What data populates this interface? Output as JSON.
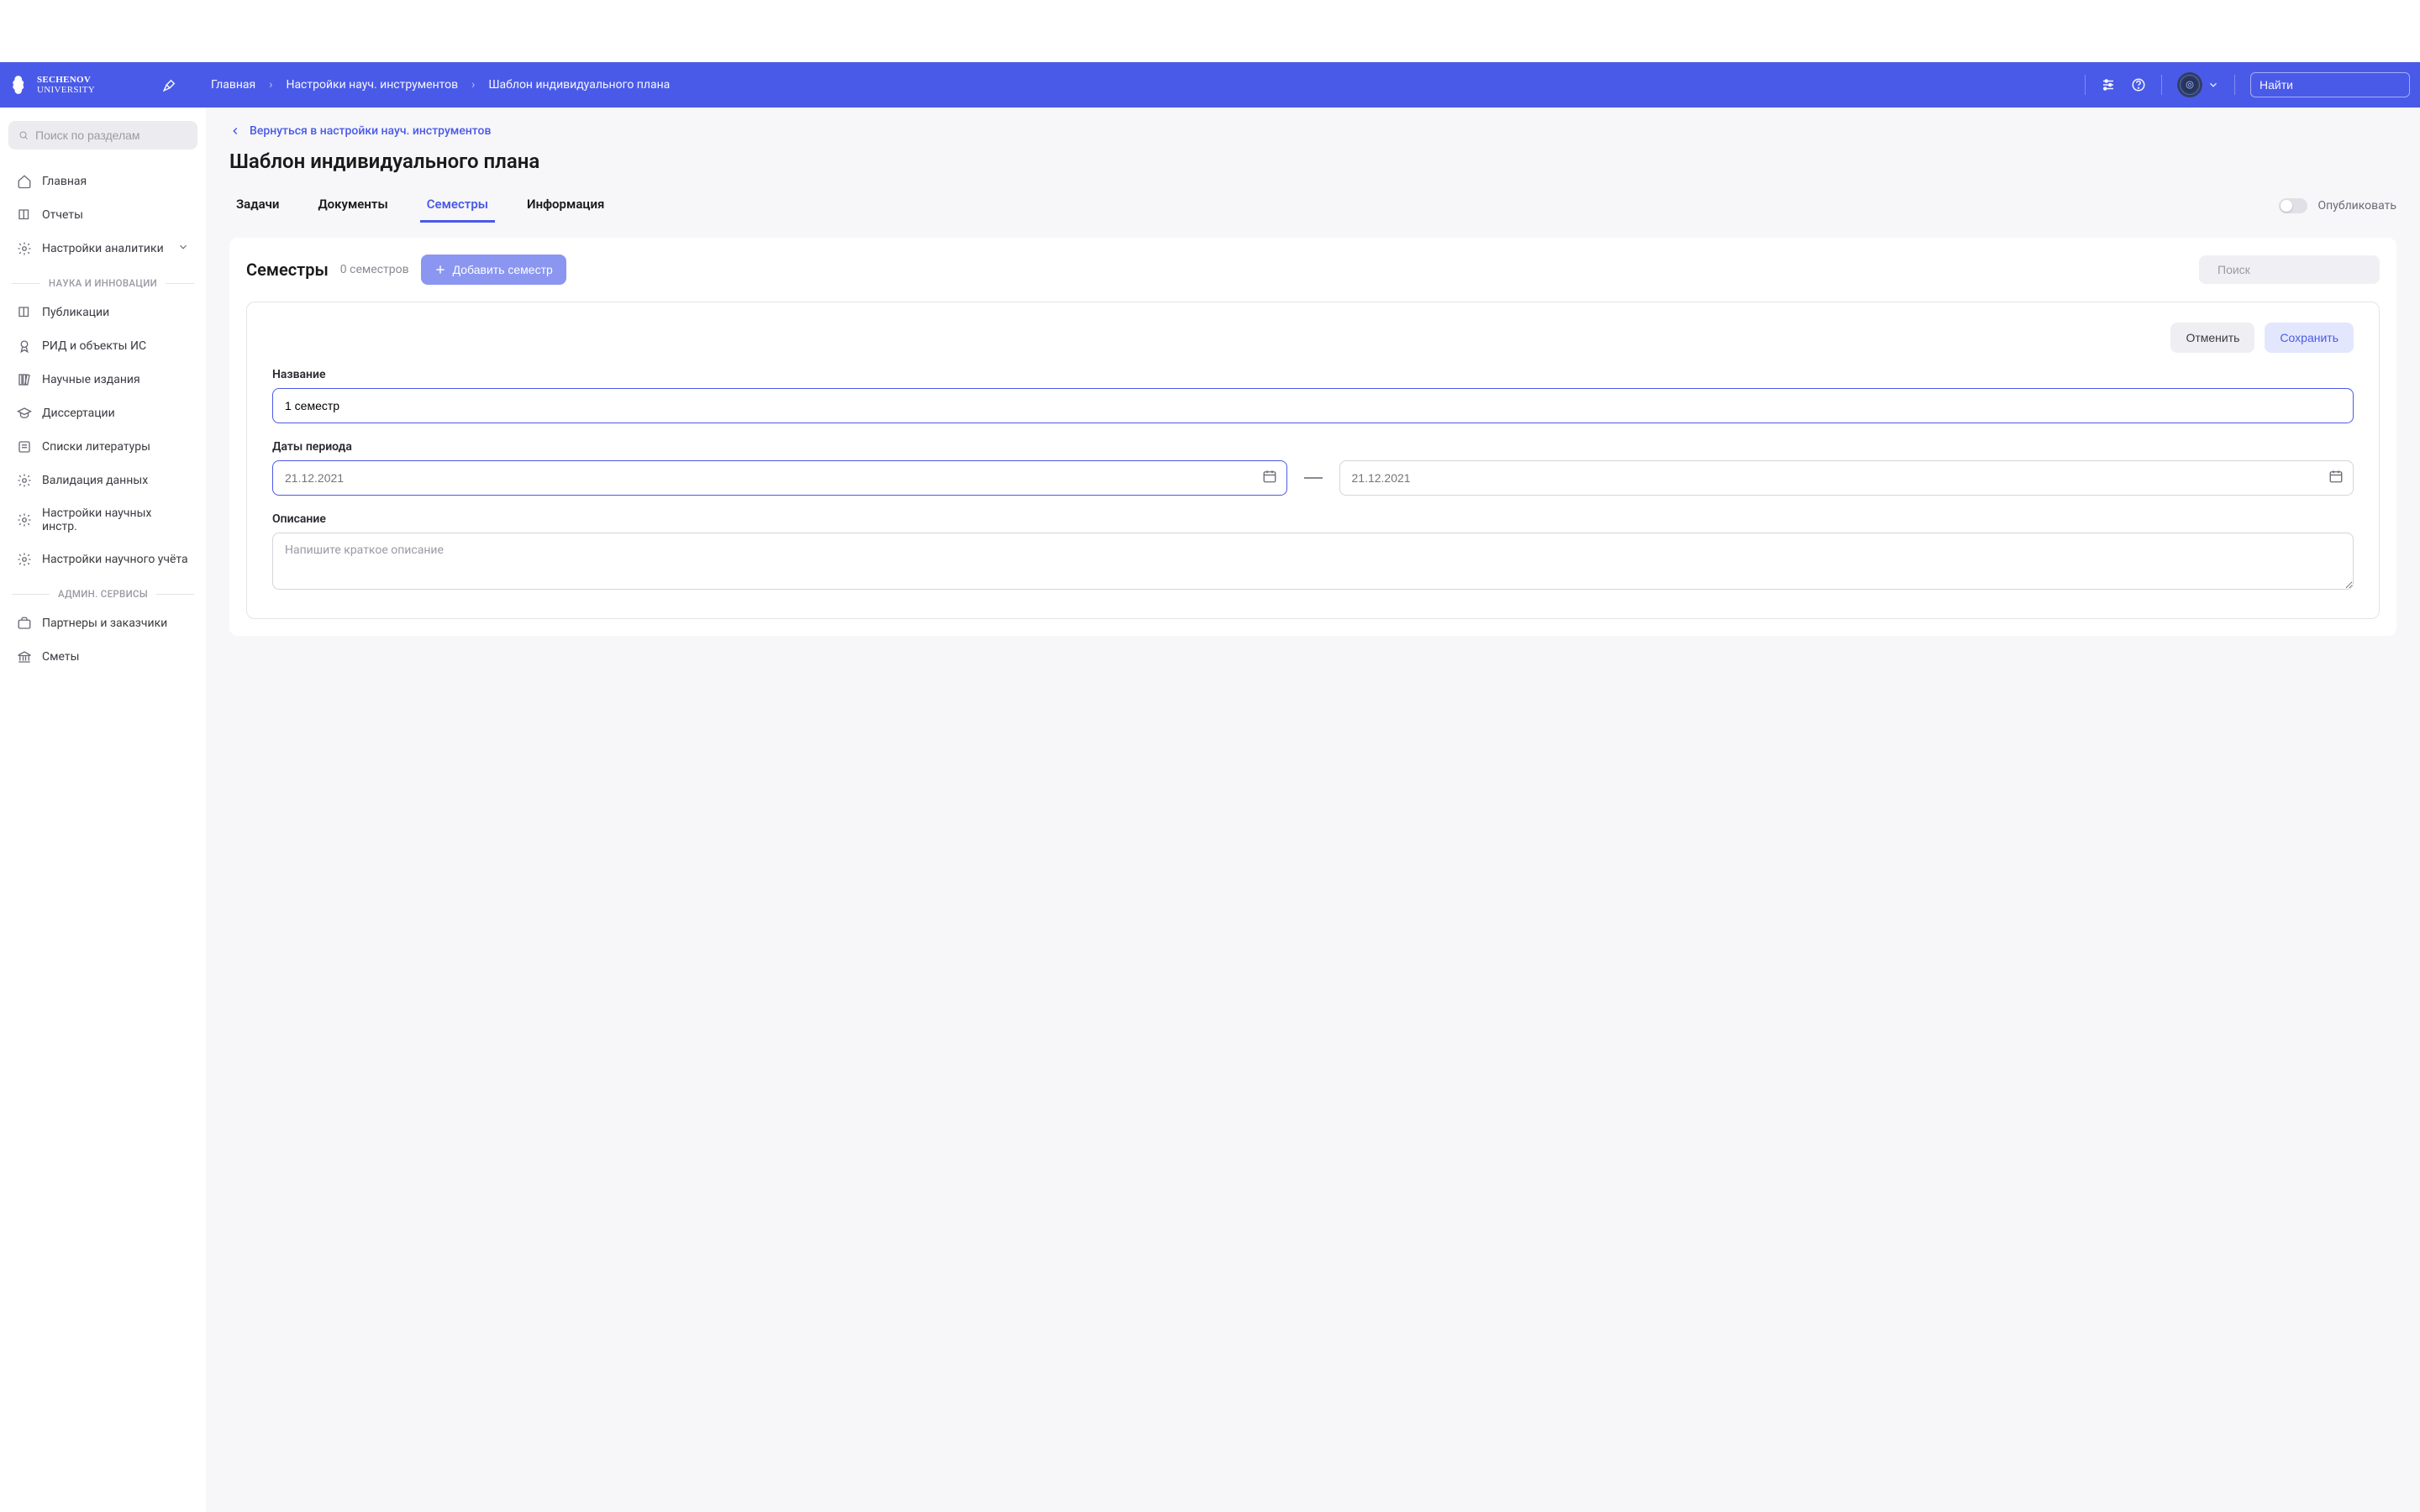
{
  "header": {
    "brand_line1": "Sechenov",
    "brand_line2": "University",
    "breadcrumbs": [
      "Главная",
      "Настройки науч. инструментов",
      "Шаблон индивидуального плана"
    ],
    "search_placeholder": "Найти"
  },
  "sidebar": {
    "search_placeholder": "Поиск по разделам",
    "items_top": [
      {
        "label": "Главная",
        "icon": "home"
      },
      {
        "label": "Отчеты",
        "icon": "book"
      },
      {
        "label": "Настройки аналитики",
        "icon": "gear",
        "expandable": true
      }
    ],
    "section_science": "НАУКА И ИННОВАЦИИ",
    "items_science": [
      {
        "label": "Публикации",
        "icon": "book"
      },
      {
        "label": "РИД и объекты ИС",
        "icon": "award"
      },
      {
        "label": "Научные издания",
        "icon": "library"
      },
      {
        "label": "Диссертации",
        "icon": "grad"
      },
      {
        "label": "Списки литературы",
        "icon": "list"
      },
      {
        "label": "Валидация данных",
        "icon": "gear"
      },
      {
        "label": "Настройки научных инстр.",
        "icon": "gear"
      },
      {
        "label": "Настройки научного учёта",
        "icon": "gear"
      }
    ],
    "section_admin": "АДМИН. СЕРВИСЫ",
    "items_admin": [
      {
        "label": "Партнеры и заказчики",
        "icon": "briefcase"
      },
      {
        "label": "Сметы",
        "icon": "bank"
      }
    ]
  },
  "main": {
    "back_link": "Вернуться в настройки науч. инструментов",
    "title": "Шаблон индивидуального плана",
    "tabs": [
      {
        "label": "Задачи",
        "active": false
      },
      {
        "label": "Документы",
        "active": false
      },
      {
        "label": "Семестры",
        "active": true
      },
      {
        "label": "Информация",
        "active": false
      }
    ],
    "publish_label": "Опубликовать"
  },
  "semesters_card": {
    "title": "Семестры",
    "count_label": "0 семестров",
    "add_button": "Добавить семестр",
    "search_placeholder": "Поиск"
  },
  "form": {
    "cancel": "Отменить",
    "save": "Сохранить",
    "name_label": "Название",
    "name_value": "1 семестр",
    "period_label": "Даты периода",
    "date_from_placeholder": "21.12.2021",
    "date_to_placeholder": "21.12.2021",
    "desc_label": "Описание",
    "desc_placeholder": "Напишите краткое описание"
  }
}
